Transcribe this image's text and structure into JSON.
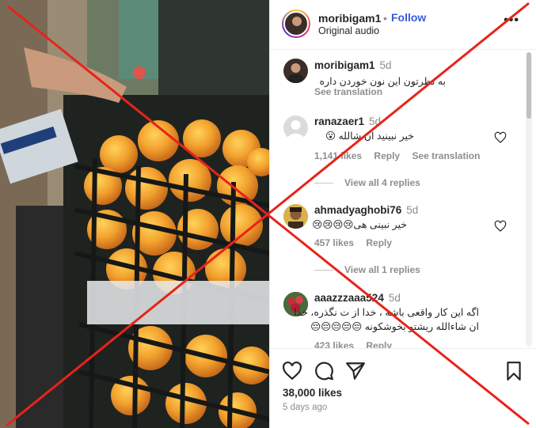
{
  "header": {
    "username": "moribigam1",
    "dot": "•",
    "follow_label": "Follow",
    "audio": "Original audio",
    "more": "•••"
  },
  "caption": {
    "username": "moribigam1",
    "age": "5d",
    "text": "به نظرتون این نون خوردن داره",
    "translate": "See translation"
  },
  "comments": [
    {
      "username": "ranazaer1",
      "age": "5d",
      "text": "خیر نبینید ان شالله 😮",
      "likes": "1,141 likes",
      "reply": "Reply",
      "translate": "See translation",
      "view_replies": "View all 4 replies"
    },
    {
      "username": "ahmadyaghobi76",
      "age": "5d",
      "text": "خیر نبینی هی😢😢😢😢",
      "likes": "457 likes",
      "reply": "Reply",
      "view_replies": "View all 1 replies"
    },
    {
      "username": "aaazzzaaa524",
      "age": "5d",
      "text_line1": "اگه این کار واقعی باشه ، خدا از ت نگذره، خدا",
      "text_line2": "ان شاءالله ریشتو بخوشکونه 😔😔😔😔😔",
      "likes": "423 likes",
      "reply": "Reply"
    }
  ],
  "footer": {
    "likes": "38,000 likes",
    "date": "5 days ago"
  },
  "icons": {
    "like": "heart-icon",
    "comment": "comment-bubble-icon",
    "share": "paper-plane-icon",
    "save": "bookmark-icon"
  },
  "colors": {
    "follow": "#3b5bdb",
    "overlay_x": "#e8231a"
  }
}
